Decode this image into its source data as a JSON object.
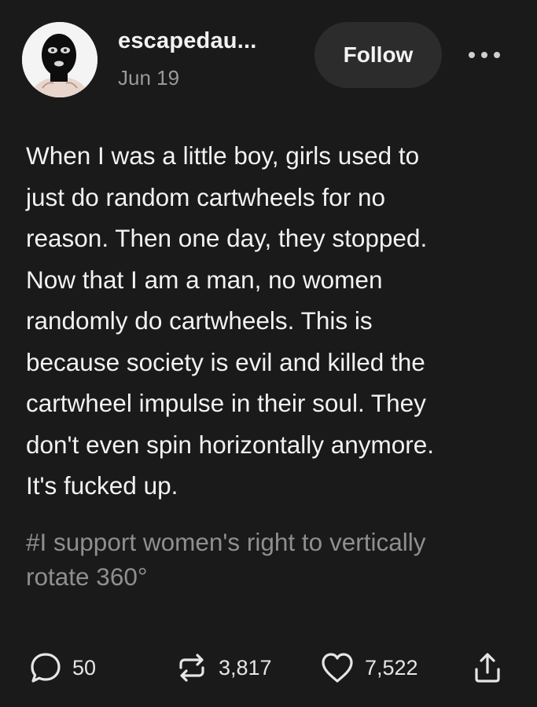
{
  "post": {
    "author": {
      "username": "escapedau...",
      "date": "Jun 19",
      "avatar_icon": "balaclava-avatar-icon"
    },
    "follow_label": "Follow",
    "more_icon": "ellipsis-icon",
    "body": "When I was a little boy, girls used to\njust do random cartwheels for no\nreason. Then one day, they stopped.\nNow that I am a man, no women\nrandomly do cartwheels. This is\nbecause society is evil and killed the\ncartwheel impulse in their soul. They\ndon't even spin horizontally anymore.\nIt's fucked up.",
    "tags": "#I support women's right to vertically\nrotate 360°",
    "actions": {
      "comments": {
        "icon": "comment-icon",
        "count": "50"
      },
      "reblogs": {
        "icon": "reblog-icon",
        "count": "3,817"
      },
      "likes": {
        "icon": "heart-icon",
        "count": "7,522"
      },
      "share": {
        "icon": "share-icon"
      }
    },
    "colors": {
      "background": "#1a1a1a",
      "text": "#f2f2f2",
      "muted": "#8f8f8f",
      "button": "#2c2c2c"
    }
  }
}
